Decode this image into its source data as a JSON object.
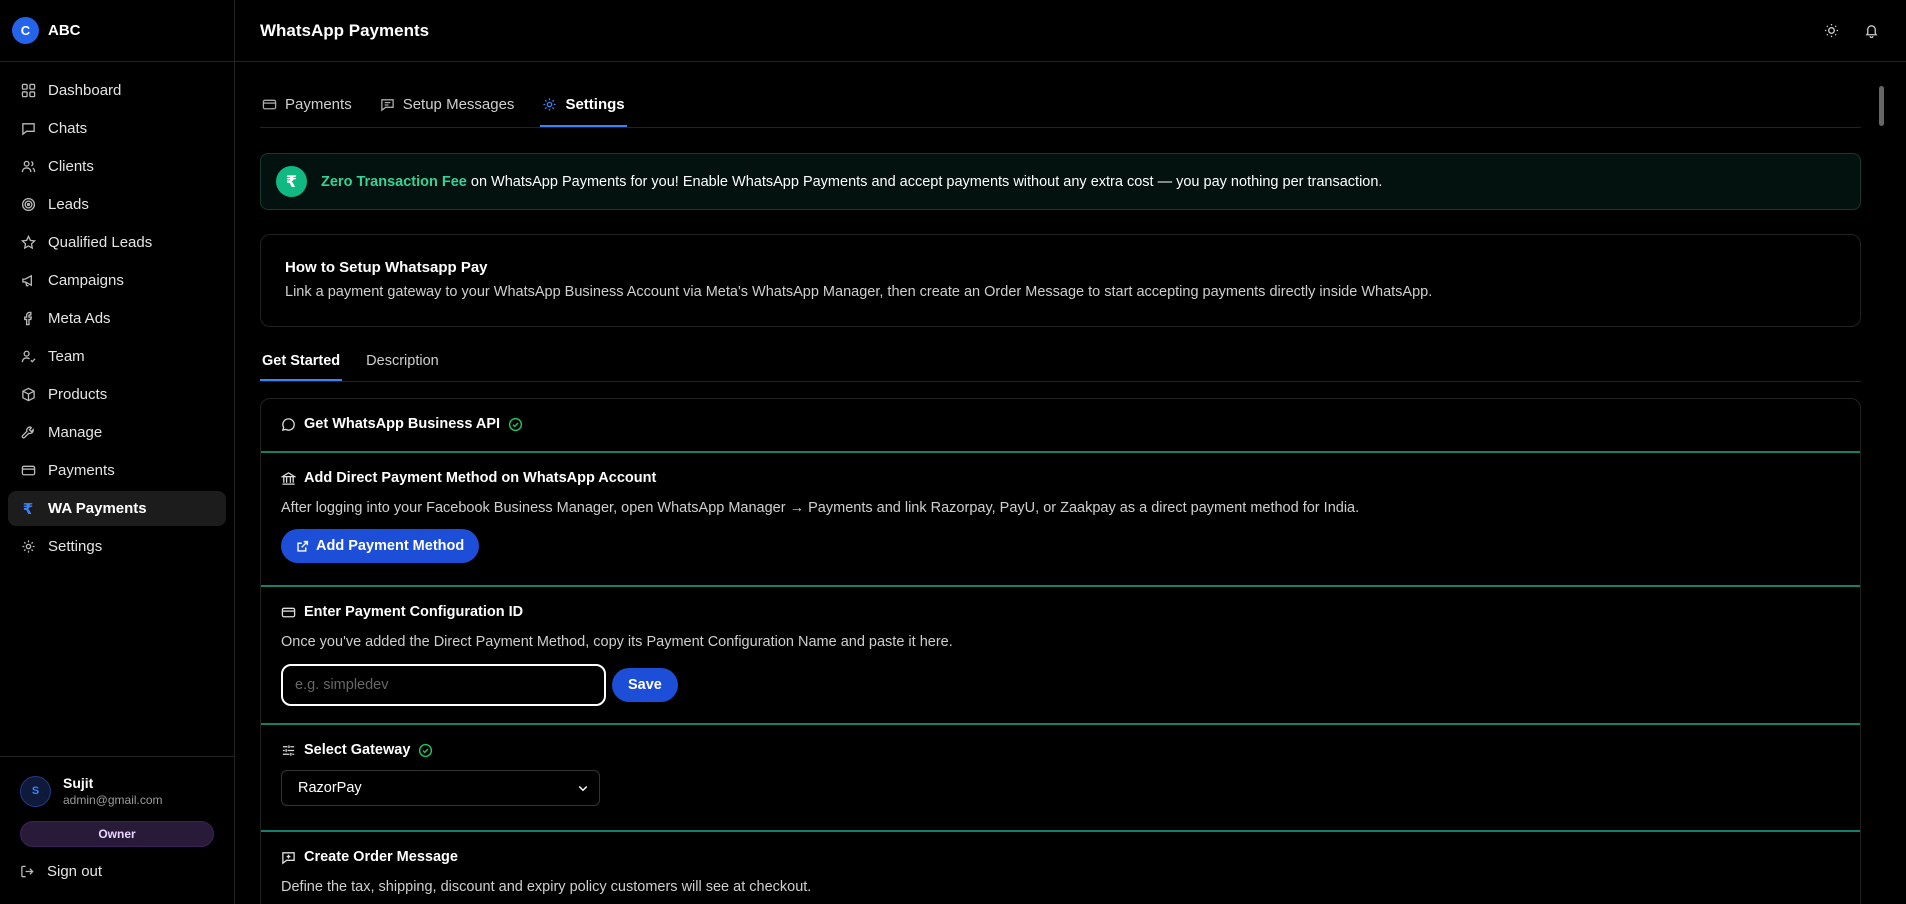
{
  "brand": {
    "initial": "C",
    "name": "ABC"
  },
  "nav": [
    {
      "label": "Dashboard",
      "icon": "dashboard-icon"
    },
    {
      "label": "Chats",
      "icon": "chat-icon"
    },
    {
      "label": "Clients",
      "icon": "users-icon"
    },
    {
      "label": "Leads",
      "icon": "target-icon"
    },
    {
      "label": "Qualified Leads",
      "icon": "star-icon"
    },
    {
      "label": "Campaigns",
      "icon": "megaphone-icon"
    },
    {
      "label": "Meta Ads",
      "icon": "facebook-icon"
    },
    {
      "label": "Team",
      "icon": "team-icon"
    },
    {
      "label": "Products",
      "icon": "box-icon"
    },
    {
      "label": "Manage",
      "icon": "wrench-icon"
    },
    {
      "label": "Payments",
      "icon": "card-icon"
    },
    {
      "label": "WA Payments",
      "icon": "rupee-icon"
    },
    {
      "label": "Settings",
      "icon": "gear-icon"
    }
  ],
  "user": {
    "initial": "S",
    "name": "Sujit",
    "email": "admin@gmail.com",
    "role": "Owner",
    "signout": "Sign out"
  },
  "header": {
    "title": "WhatsApp Payments"
  },
  "tabs": {
    "payments": "Payments",
    "setup": "Setup Messages",
    "settings": "Settings"
  },
  "banner": {
    "highlight": "Zero Transaction Fee",
    "text": " on WhatsApp Payments for you! Enable WhatsApp Payments and accept payments without any extra cost — you pay nothing per transaction.",
    "symbol": "₹"
  },
  "howto": {
    "title": "How to Setup Whatsapp Pay",
    "desc": "Link a payment gateway to your WhatsApp Business Account via Meta's WhatsApp Manager, then create an Order Message to start accepting payments directly inside WhatsApp."
  },
  "subtabs": {
    "get_started": "Get Started",
    "description": "Description"
  },
  "steps": {
    "api": {
      "title": "Get WhatsApp Business API"
    },
    "method": {
      "title": "Add Direct Payment Method on WhatsApp Account",
      "desc": "After logging into your Facebook Business Manager, open WhatsApp Manager → Payments and link Razorpay, PayU, or Zaakpay as a direct payment method for India.",
      "button": "Add Payment Method"
    },
    "config": {
      "title": "Enter Payment Configuration ID",
      "desc": "Once you've added the Direct Payment Method, copy its Payment Configuration Name and paste it here.",
      "placeholder": "e.g. simpledev",
      "save": "Save"
    },
    "gateway": {
      "title": "Select Gateway",
      "selected": "RazorPay"
    },
    "order": {
      "title": "Create Order Message",
      "desc": "Define the tax, shipping, discount and expiry policy customers will see at checkout."
    }
  },
  "colors": {
    "accent": "#3b82f6",
    "success": "#22c55e",
    "banner_highlight": "#34d399",
    "divider": "#14806a"
  }
}
